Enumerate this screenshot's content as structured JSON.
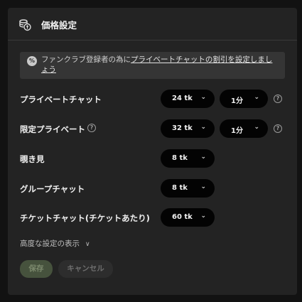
{
  "header": {
    "title": "価格設定",
    "icon": "price-coins-icon"
  },
  "notice": {
    "icon_text": "%",
    "prefix": "ファンクラブ登録者の為に",
    "link": "プライベートチャットの割引を設定しましょう"
  },
  "rows": [
    {
      "label": "プライベートチャット",
      "price": "24 tk",
      "duration": "1分",
      "help": "?"
    },
    {
      "label": "限定プライベート",
      "price": "32 tk",
      "duration": "1分",
      "help": "?"
    },
    {
      "label": "覗き見",
      "price": "8 tk"
    },
    {
      "label": "グループチャット",
      "price": "8 tk"
    },
    {
      "label": "チケットチャット(チケットあたり)",
      "price": "60 tk"
    }
  ],
  "advanced": {
    "label": "高度な設定の表示"
  },
  "buttons": {
    "save": "保存",
    "cancel": "キャンセル"
  },
  "colors": {
    "panel": "#232323",
    "select_bg": "#030303",
    "save_bg": "#46523d"
  }
}
